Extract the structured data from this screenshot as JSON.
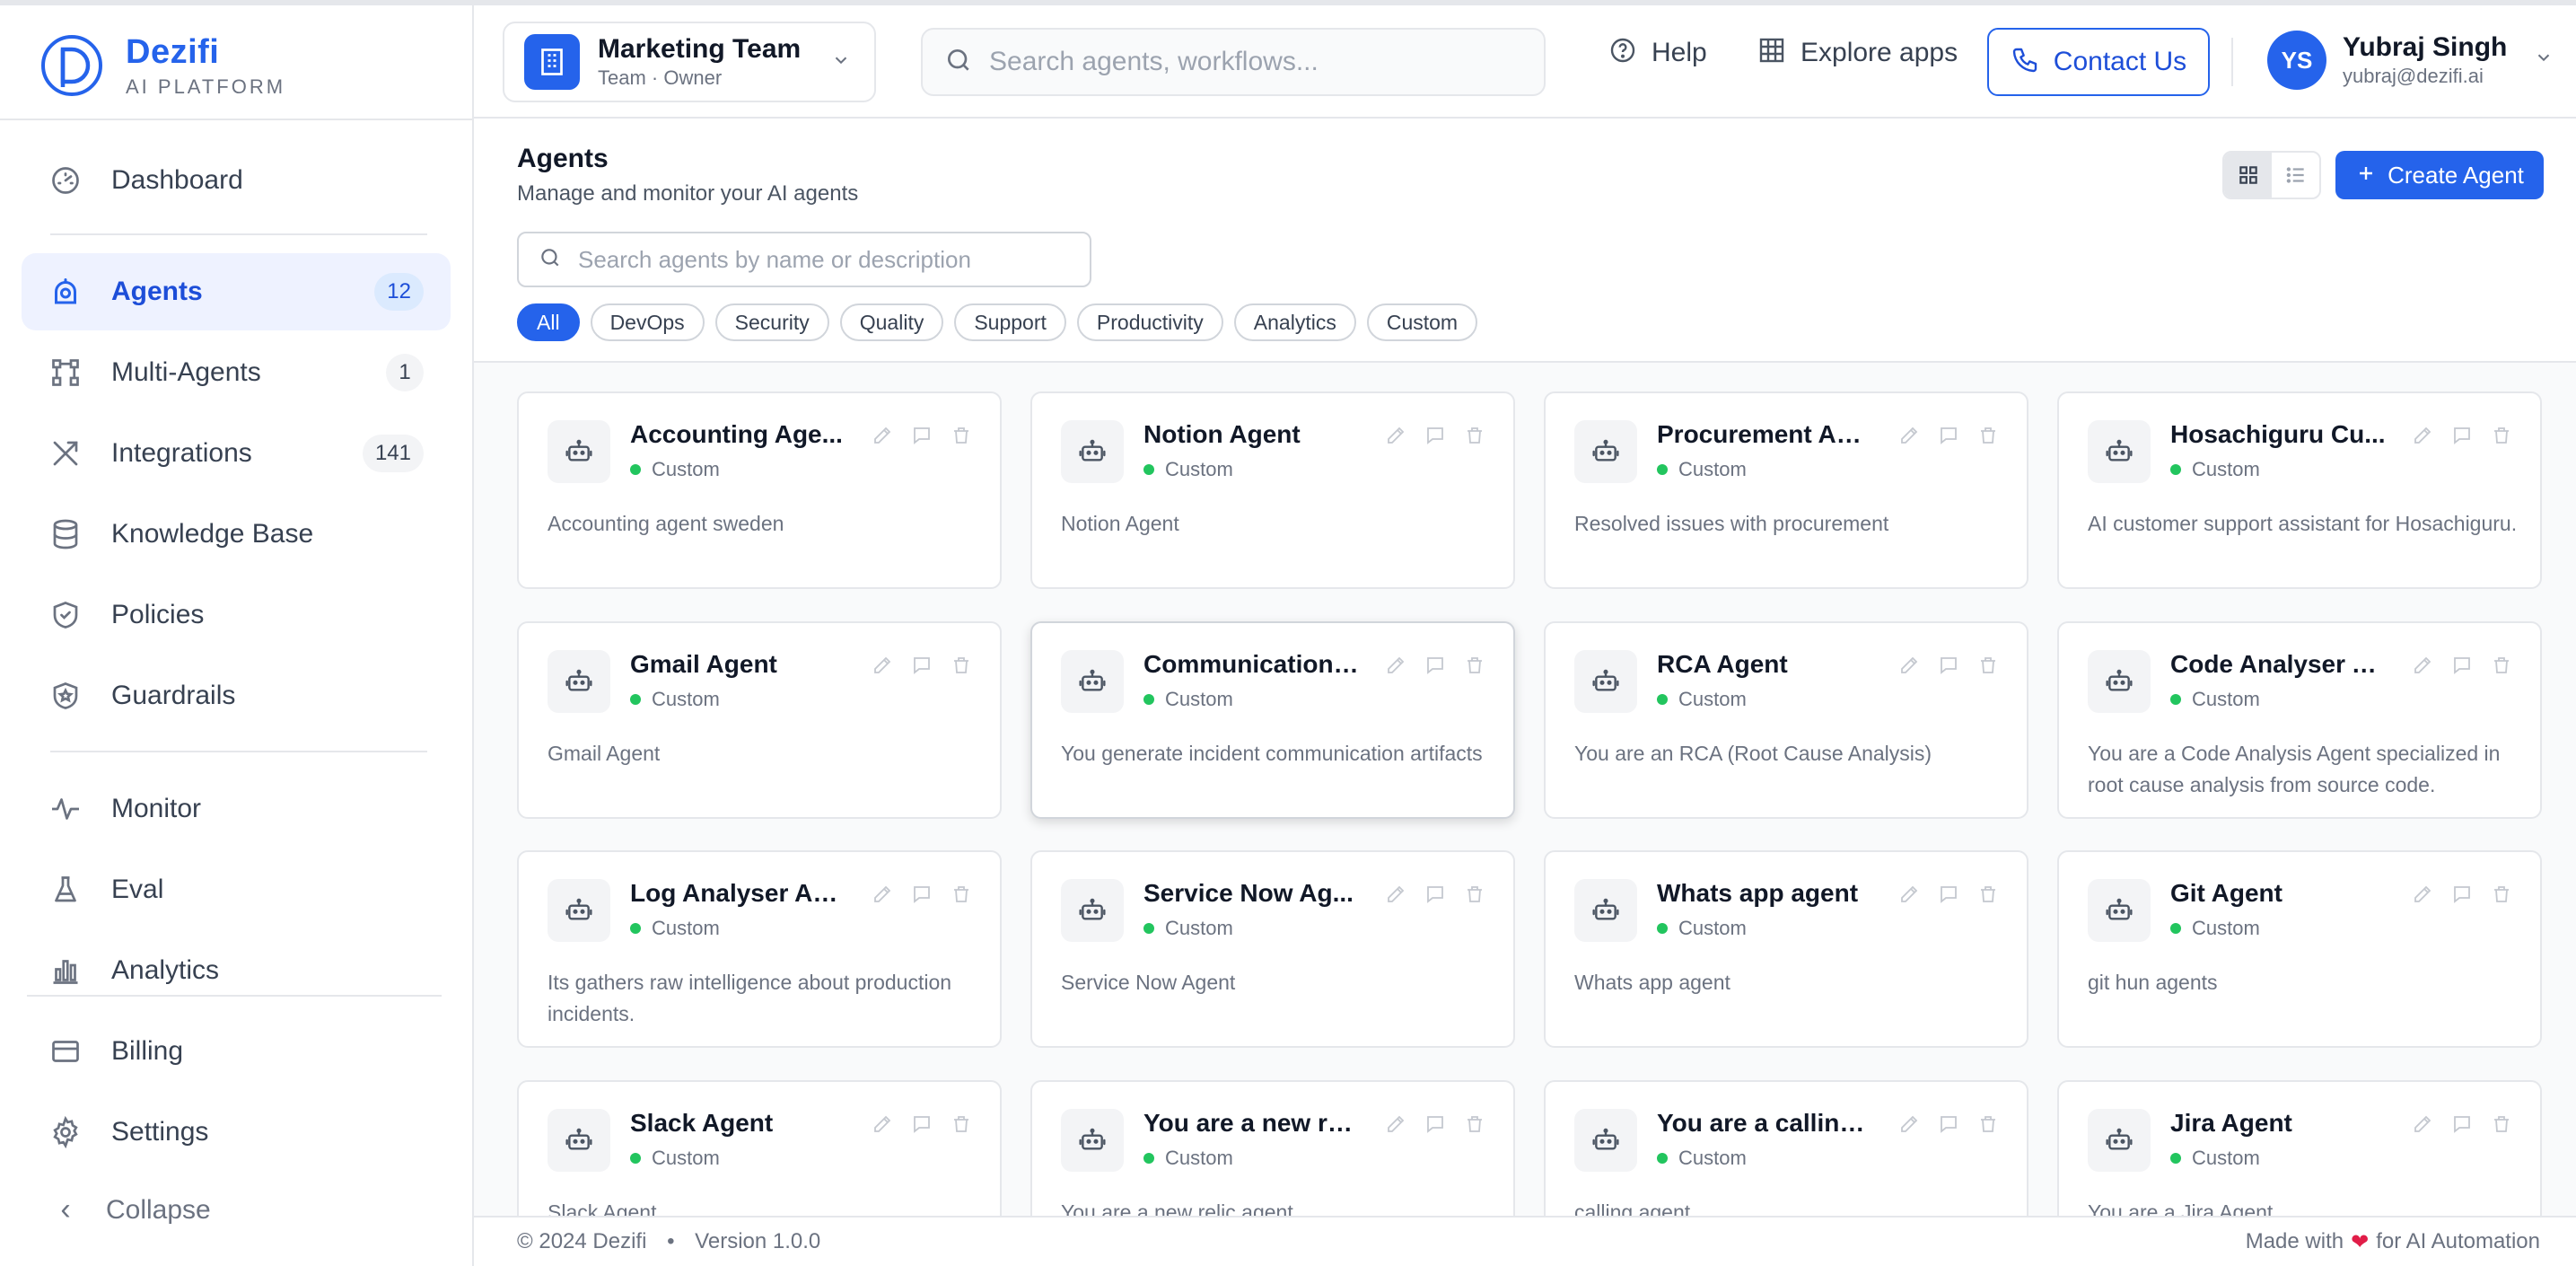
{
  "brand": {
    "name": "Dezifi",
    "subtitle": "AI PLATFORM",
    "accent": "#2563eb"
  },
  "sidebar": {
    "items": [
      {
        "label": "Dashboard",
        "icon": "gauge-icon",
        "badge": ""
      },
      {
        "label": "Agents",
        "icon": "agent-icon",
        "badge": "12",
        "active": true
      },
      {
        "label": "Multi-Agents",
        "icon": "workflow-icon",
        "badge": "1"
      },
      {
        "label": "Integrations",
        "icon": "tools-icon",
        "badge": "141"
      },
      {
        "label": "Knowledge Base",
        "icon": "database-icon",
        "badge": ""
      },
      {
        "label": "Policies",
        "icon": "shield-check-icon",
        "badge": ""
      },
      {
        "label": "Guardrails",
        "icon": "shield-star-icon",
        "badge": ""
      },
      {
        "label": "Monitor",
        "icon": "activity-icon",
        "badge": ""
      },
      {
        "label": "Eval",
        "icon": "flask-icon",
        "badge": ""
      },
      {
        "label": "Analytics",
        "icon": "bar-chart-icon",
        "badge": ""
      },
      {
        "label": "Billing",
        "icon": "card-icon",
        "badge": ""
      },
      {
        "label": "Settings",
        "icon": "gear-icon",
        "badge": ""
      }
    ],
    "collapse_label": "Collapse"
  },
  "header": {
    "team_name": "Marketing Team",
    "team_role": "Team · Owner",
    "search_placeholder": "Search agents, workflows...",
    "help_label": "Help",
    "explore_label": "Explore apps",
    "contact_label": "Contact Us",
    "user_initials": "YS",
    "user_name": "Yubraj Singh",
    "user_email": "yubraj@dezifi.ai"
  },
  "page": {
    "title": "Agents",
    "subtitle": "Manage and monitor your AI agents",
    "create_label": "Create Agent",
    "search_placeholder": "Search agents by name or description",
    "filters": [
      "All",
      "DevOps",
      "Security",
      "Quality",
      "Support",
      "Productivity",
      "Analytics",
      "Custom"
    ],
    "active_filter": "All"
  },
  "agents": [
    {
      "name": "Accounting Age...",
      "type": "Custom",
      "desc": "Accounting agent sweden"
    },
    {
      "name": "Notion Agent",
      "type": "Custom",
      "desc": "Notion Agent"
    },
    {
      "name": "Procurement Ag...",
      "type": "Custom",
      "desc": "Resolved issues with procurement"
    },
    {
      "name": "Hosachiguru Cu...",
      "type": "Custom",
      "desc": "AI customer support assistant for Hosachiguru."
    },
    {
      "name": "Gmail Agent",
      "type": "Custom",
      "desc": "Gmail Agent"
    },
    {
      "name": "Communication ...",
      "type": "Custom",
      "desc": "You generate incident communication artifacts"
    },
    {
      "name": "RCA Agent",
      "type": "Custom",
      "desc": "You are an RCA (Root Cause Analysis)"
    },
    {
      "name": "Code Analyser A...",
      "type": "Custom",
      "desc": "You are a Code Analysis Agent specialized in root cause analysis from source code."
    },
    {
      "name": "Log Analyser Ag...",
      "type": "Custom",
      "desc": "Its gathers raw intelligence about production incidents."
    },
    {
      "name": "Service Now Ag...",
      "type": "Custom",
      "desc": "Service Now Agent"
    },
    {
      "name": "Whats app agent",
      "type": "Custom",
      "desc": "Whats app agent"
    },
    {
      "name": "Git Agent",
      "type": "Custom",
      "desc": "git hun agents"
    },
    {
      "name": "Slack Agent",
      "type": "Custom",
      "desc": "Slack Agent"
    },
    {
      "name": "You are a new re...",
      "type": "Custom",
      "desc": "You are a new relic agent"
    },
    {
      "name": "You are a calling...",
      "type": "Custom",
      "desc": "calling agent"
    },
    {
      "name": "Jira Agent",
      "type": "Custom",
      "desc": "You are a Jira Agent"
    }
  ],
  "footer": {
    "copyright": "© 2024 Dezifi",
    "version": "Version 1.0.0",
    "made_with_prefix": "Made with",
    "made_with_suffix": "for AI Automation"
  }
}
